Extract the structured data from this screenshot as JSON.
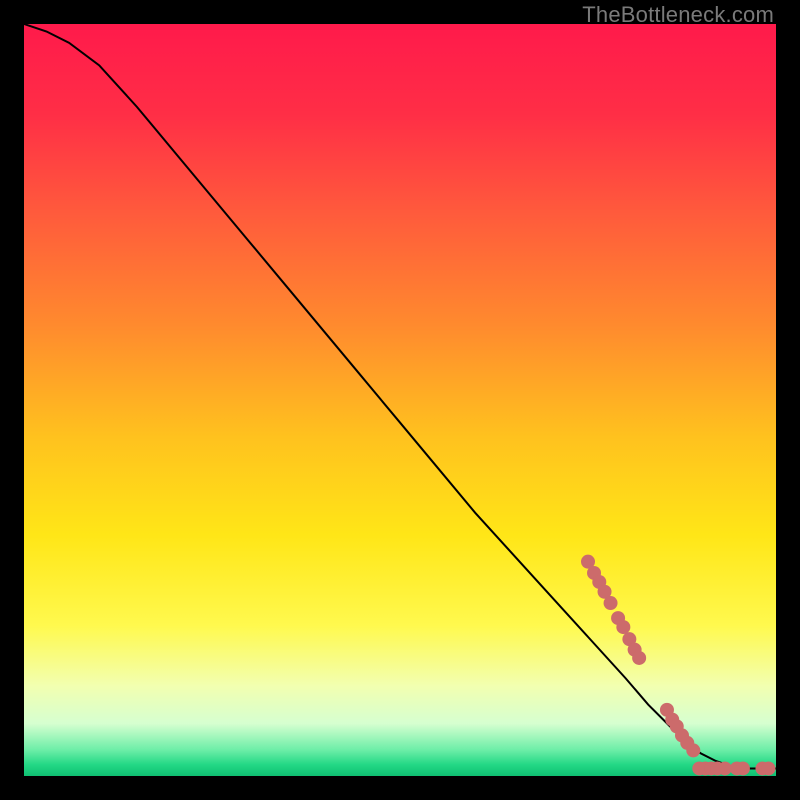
{
  "watermark": "TheBottleneck.com",
  "chart_data": {
    "type": "line",
    "title": "",
    "xlabel": "",
    "ylabel": "",
    "xlim": [
      0,
      100
    ],
    "ylim": [
      0,
      100
    ],
    "grid": false,
    "background_gradient_stops": [
      {
        "offset": 0.0,
        "color": "#ff1a4b"
      },
      {
        "offset": 0.12,
        "color": "#ff2e46"
      },
      {
        "offset": 0.25,
        "color": "#ff5a3c"
      },
      {
        "offset": 0.4,
        "color": "#ff8a2e"
      },
      {
        "offset": 0.55,
        "color": "#ffc21e"
      },
      {
        "offset": 0.68,
        "color": "#ffe617"
      },
      {
        "offset": 0.8,
        "color": "#fff94e"
      },
      {
        "offset": 0.88,
        "color": "#f2ffb0"
      },
      {
        "offset": 0.93,
        "color": "#d6ffd0"
      },
      {
        "offset": 0.965,
        "color": "#6eeea8"
      },
      {
        "offset": 0.985,
        "color": "#23d885"
      },
      {
        "offset": 1.0,
        "color": "#0fbf72"
      }
    ],
    "series": [
      {
        "name": "curve",
        "stroke": "#000000",
        "stroke_width": 2,
        "x": [
          0,
          3,
          6,
          10,
          15,
          20,
          25,
          30,
          35,
          40,
          45,
          50,
          55,
          60,
          65,
          70,
          75,
          80,
          83,
          86,
          88,
          90,
          92,
          94,
          96,
          98,
          100
        ],
        "y": [
          100,
          99,
          97.5,
          94.5,
          89,
          83,
          77,
          71,
          65,
          59,
          53,
          47,
          41,
          35,
          29.5,
          24,
          18.5,
          13,
          9.5,
          6.5,
          4.5,
          3,
          2,
          1.3,
          1,
          1,
          1
        ]
      }
    ],
    "scatter": [
      {
        "name": "points-upper-cluster",
        "color": "#cc6b6b",
        "radius": 7,
        "points": [
          {
            "x": 75.0,
            "y": 28.5
          },
          {
            "x": 75.8,
            "y": 27.0
          },
          {
            "x": 76.5,
            "y": 25.8
          },
          {
            "x": 77.2,
            "y": 24.5
          },
          {
            "x": 78.0,
            "y": 23.0
          },
          {
            "x": 79.0,
            "y": 21.0
          },
          {
            "x": 79.7,
            "y": 19.8
          },
          {
            "x": 80.5,
            "y": 18.2
          },
          {
            "x": 81.2,
            "y": 16.8
          },
          {
            "x": 81.8,
            "y": 15.7
          }
        ]
      },
      {
        "name": "points-lower-cluster",
        "color": "#cc6b6b",
        "radius": 7,
        "points": [
          {
            "x": 85.5,
            "y": 8.8
          },
          {
            "x": 86.2,
            "y": 7.5
          },
          {
            "x": 86.8,
            "y": 6.6
          },
          {
            "x": 87.5,
            "y": 5.4
          },
          {
            "x": 88.2,
            "y": 4.4
          },
          {
            "x": 89.0,
            "y": 3.4
          }
        ]
      },
      {
        "name": "points-bottom-row",
        "color": "#cc6b6b",
        "radius": 7,
        "points": [
          {
            "x": 89.8,
            "y": 1.0
          },
          {
            "x": 90.6,
            "y": 1.0
          },
          {
            "x": 91.4,
            "y": 1.0
          },
          {
            "x": 92.2,
            "y": 1.0
          },
          {
            "x": 93.2,
            "y": 1.0
          },
          {
            "x": 94.8,
            "y": 1.0
          },
          {
            "x": 95.6,
            "y": 1.0
          },
          {
            "x": 98.2,
            "y": 1.0
          },
          {
            "x": 99.0,
            "y": 1.0
          }
        ]
      }
    ]
  }
}
